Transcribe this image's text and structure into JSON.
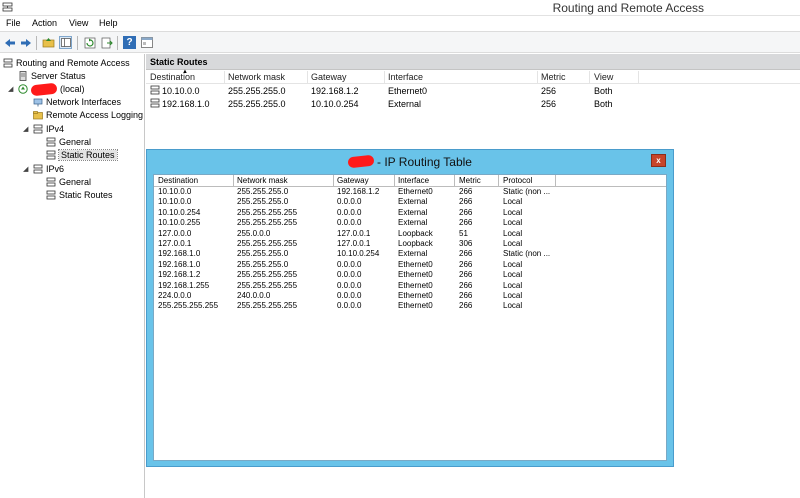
{
  "window": {
    "title": "Routing and Remote Access"
  },
  "menu": [
    "File",
    "Action",
    "View",
    "Help"
  ],
  "tree": {
    "root": "Routing and Remote Access",
    "server_status": "Server Status",
    "server_suffix": "(local)",
    "network_interfaces": "Network Interfaces",
    "remote_access_logging": "Remote Access Logging",
    "ipv4": "IPv4",
    "ipv4_general": "General",
    "ipv4_static_routes": "Static Routes",
    "ipv6": "IPv6",
    "ipv6_general": "General",
    "ipv6_static_routes": "Static Routes"
  },
  "static_routes": {
    "header": "Static Routes",
    "columns": [
      "Destination",
      "Network mask",
      "Gateway",
      "Interface",
      "Metric",
      "View"
    ],
    "rows": [
      [
        "10.10.0.0",
        "255.255.255.0",
        "192.168.1.2",
        "Ethernet0",
        "256",
        "Both"
      ],
      [
        "192.168.1.0",
        "255.255.255.0",
        "10.10.0.254",
        "External",
        "256",
        "Both"
      ]
    ]
  },
  "routing_table": {
    "title": "- IP Routing Table",
    "close": "x",
    "columns": [
      "Destination",
      "Network mask",
      "Gateway",
      "Interface",
      "Metric",
      "Protocol"
    ],
    "rows": [
      [
        "10.10.0.0",
        "255.255.255.0",
        "192.168.1.2",
        "Ethernet0",
        "266",
        "Static (non ..."
      ],
      [
        "10.10.0.0",
        "255.255.255.0",
        "0.0.0.0",
        "External",
        "266",
        "Local"
      ],
      [
        "10.10.0.254",
        "255.255.255.255",
        "0.0.0.0",
        "External",
        "266",
        "Local"
      ],
      [
        "10.10.0.255",
        "255.255.255.255",
        "0.0.0.0",
        "External",
        "266",
        "Local"
      ],
      [
        "127.0.0.0",
        "255.0.0.0",
        "127.0.0.1",
        "Loopback",
        "51",
        "Local"
      ],
      [
        "127.0.0.1",
        "255.255.255.255",
        "127.0.0.1",
        "Loopback",
        "306",
        "Local"
      ],
      [
        "192.168.1.0",
        "255.255.255.0",
        "10.10.0.254",
        "External",
        "266",
        "Static (non ..."
      ],
      [
        "192.168.1.0",
        "255.255.255.0",
        "0.0.0.0",
        "Ethernet0",
        "266",
        "Local"
      ],
      [
        "192.168.1.2",
        "255.255.255.255",
        "0.0.0.0",
        "Ethernet0",
        "266",
        "Local"
      ],
      [
        "192.168.1.255",
        "255.255.255.255",
        "0.0.0.0",
        "Ethernet0",
        "266",
        "Local"
      ],
      [
        "224.0.0.0",
        "240.0.0.0",
        "0.0.0.0",
        "Ethernet0",
        "266",
        "Local"
      ],
      [
        "255.255.255.255",
        "255.255.255.255",
        "0.0.0.0",
        "Ethernet0",
        "266",
        "Local"
      ]
    ]
  },
  "colors": {
    "dialog_frame": "#69c3e9",
    "close_button": "#c7452a",
    "redaction": "#ff1a1a",
    "pane_header": "#d8d9db"
  },
  "icons": [
    "back-arrow-icon",
    "forward-arrow-icon",
    "up-folder-icon",
    "show-hide-tree-icon",
    "refresh-icon",
    "export-list-icon",
    "help-icon",
    "properties-icon",
    "server-icon",
    "route-icon"
  ]
}
